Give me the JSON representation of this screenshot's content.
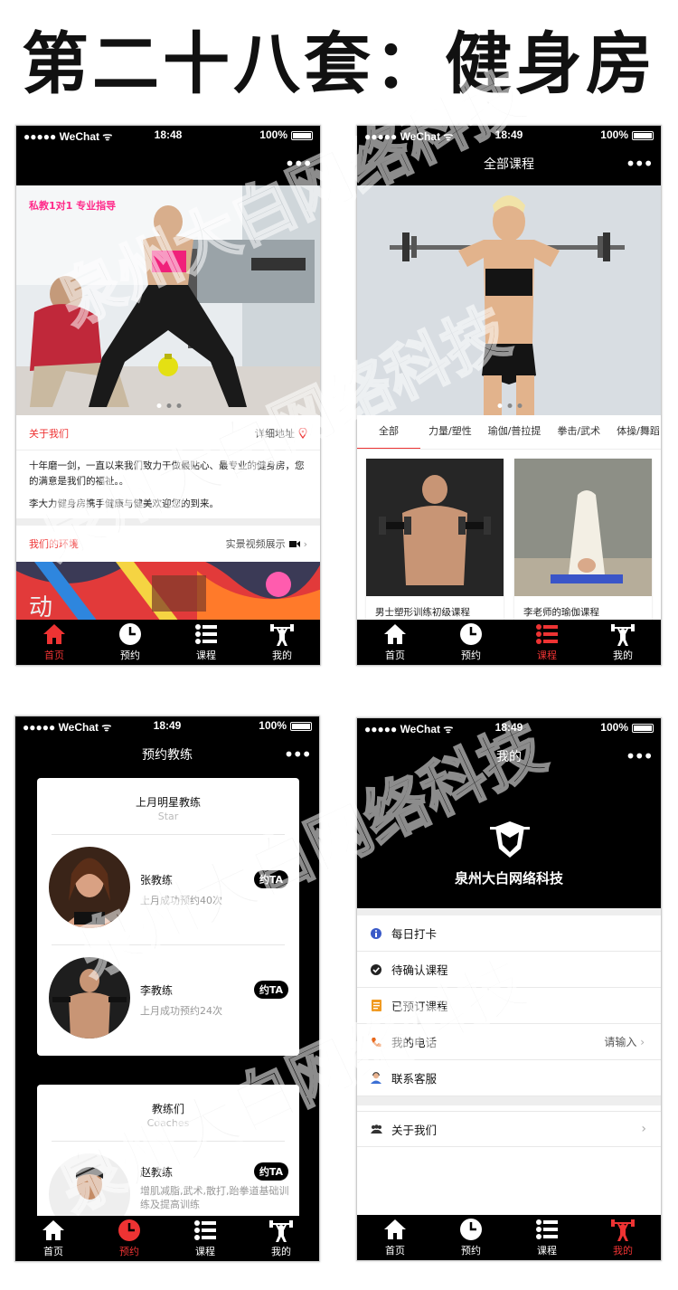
{
  "headline": "第二十八套：健身房",
  "status": {
    "p1": {
      "carrier": "●●●●● WeChat ᯤ",
      "time": "18:48",
      "battery": "100%"
    },
    "p2": {
      "carrier": "●●●●● WeChat ᯤ",
      "time": "18:49",
      "battery": "100%"
    },
    "p3": {
      "carrier": "●●●●● WeChat ᯤ",
      "time": "18:49",
      "battery": "100%"
    },
    "p4": {
      "carrier": "●●●●● WeChat ᯤ",
      "time": "18:49",
      "battery": "100%"
    }
  },
  "more": "•••",
  "tabs": [
    "首页",
    "预约",
    "课程",
    "我的"
  ],
  "home": {
    "banner_overlay": "私教1对1 专业指导",
    "about_label": "关于我们",
    "address_label": "详细地址",
    "about_text_1": "十年磨一剑，一直以来我们致力于做最贴心、最专业的健身房，您的满意是我们的福祉。。",
    "about_text_2": "李大力健身房携手健康与健美欢迎您的到来。",
    "env_label": "我们的环境",
    "video_label": "实景视频展示",
    "graffiti": "动"
  },
  "courses": {
    "nav_title": "全部课程",
    "categories": [
      "全部",
      "力量/塑性",
      "瑜伽/普拉提",
      "拳击/武术",
      "体操/舞蹈"
    ],
    "items": [
      {
        "title": "男士塑形训练初级课程"
      },
      {
        "title": "李老师的瑜伽课程"
      }
    ]
  },
  "booking": {
    "nav_title": "预约教练",
    "star_title": "上月明星教练",
    "star_sub": "Star",
    "book_btn": "约TA",
    "star_coaches": [
      {
        "name": "张教练",
        "desc": "上月成功预约40次"
      },
      {
        "name": "李教练",
        "desc": "上月成功预约24次"
      }
    ],
    "coaches_title": "教练们",
    "coaches_sub": "Coaches",
    "coaches": [
      {
        "name": "赵教练",
        "desc": "增肌减脂,武术,散打,跆拳道基础训练及提高训练"
      }
    ]
  },
  "mine": {
    "nav_title": "我的",
    "brand": "泉州大白网络科技",
    "menu": [
      {
        "label": "每日打卡",
        "icon": "info-icon"
      },
      {
        "label": "待确认课程",
        "icon": "check-icon"
      },
      {
        "label": "已预订课程",
        "icon": "document-icon"
      },
      {
        "label": "我的电话",
        "icon": "phone-icon",
        "value": "请输入"
      },
      {
        "label": "联系客服",
        "icon": "support-agent-icon"
      }
    ],
    "about": {
      "label": "关于我们",
      "icon": "group-icon"
    }
  },
  "watermark_text": "泉州大白网络科技",
  "colors": {
    "accent": "#e33333",
    "bar": "#000000",
    "pink_overlay": "#ff2a8a"
  }
}
